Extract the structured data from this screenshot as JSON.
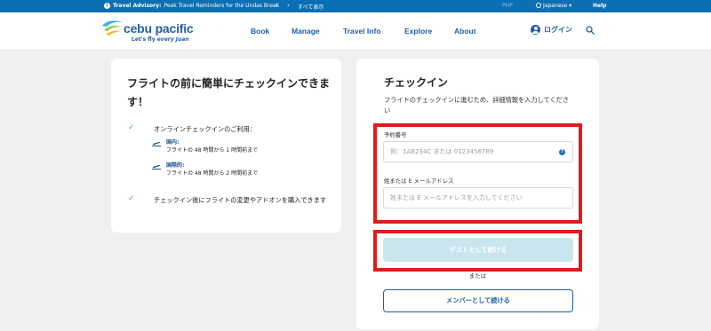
{
  "topbar": {
    "advisory_label": "Travel Advisory:",
    "advisory_text": "Peak Travel Reminders for the Undas Break",
    "show_all": "すべて表示",
    "currency": "PHP",
    "language": "Japanese",
    "help": "Help"
  },
  "header": {
    "brand": "cebu pacific",
    "tagline_prefix": "Let's fly ",
    "tagline_em": "every Juan",
    "nav": [
      "Book",
      "Manage",
      "Travel Info",
      "Explore",
      "About"
    ],
    "login": "ログイン"
  },
  "left_card": {
    "title": "フライトの前に簡単にチェックインできます！",
    "item1": "オンラインチェックインのご利用：",
    "domestic_label": "国内:",
    "domestic_text": "フライトの 48 時間から 1 時間前まで",
    "intl_label": "国際的:",
    "intl_text": "フライトの 48 時間から 2 時間前まで",
    "item2": "チェックイン後にフライトの変更やアドオンを購入できます"
  },
  "checkin": {
    "title": "チェックイン",
    "subtitle": "フライトのチェックインに進むため、詳細情報を入力してください",
    "booking_label": "予約番号",
    "booking_placeholder": "例：1AB234C または 0123456789",
    "name_label": "姓または E メールアドレス",
    "name_placeholder": "姓または E メールアドレスを入力してください",
    "guest_button": "ゲストとして続ける",
    "or": "または",
    "member_button": "メンバーとして続ける"
  },
  "colors": {
    "brand_blue": "#1f5fa8",
    "advisory_bar": "#0b6fb3",
    "annotation_red": "#e01b1b",
    "guest_button_disabled": "#c9e6ee"
  }
}
